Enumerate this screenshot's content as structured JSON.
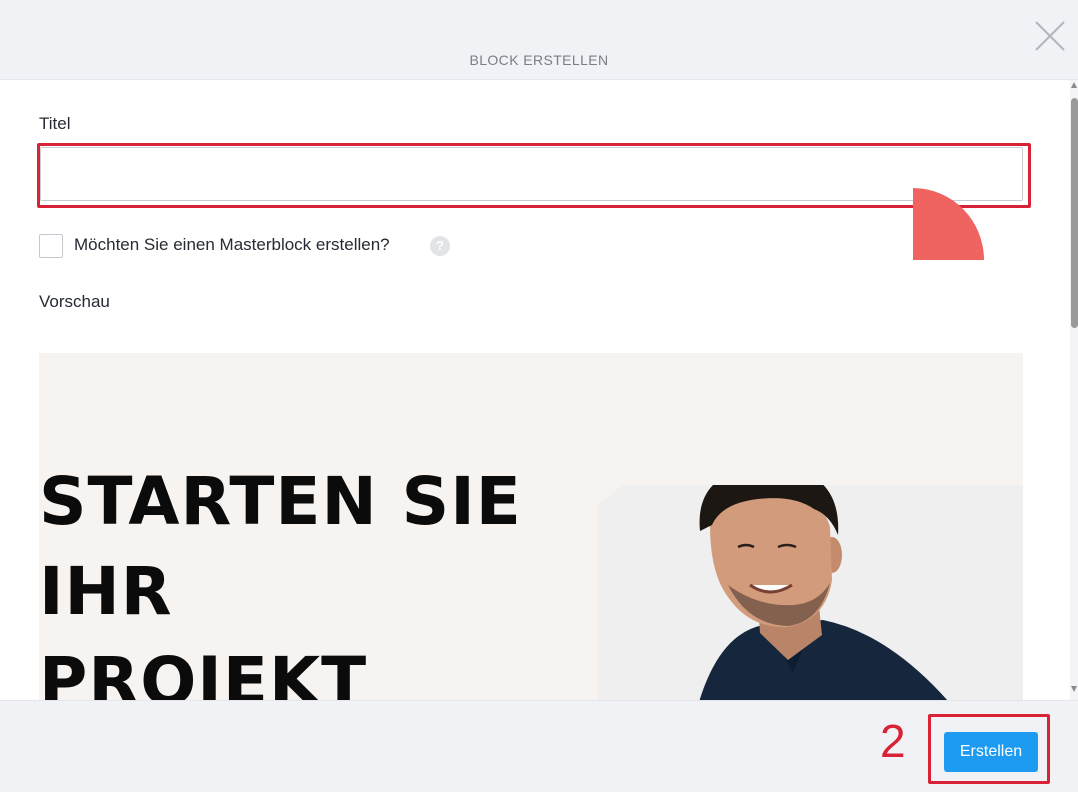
{
  "dialog": {
    "title": "BLOCK ERSTELLEN",
    "close_icon": "close-icon"
  },
  "form": {
    "title_label": "Titel",
    "title_value": "",
    "title_placeholder": "",
    "master_block_label": "Möchten Sie einen Masterblock erstellen?",
    "master_block_checked": false,
    "help_icon": "question-mark-icon",
    "help_symbol": "?",
    "preview_label": "Vorschau"
  },
  "preview": {
    "hero_line1": "STARTEN SIE",
    "hero_line2": "IHR",
    "hero_line3": "PROJEKT",
    "accent_color": "#ef6461",
    "background_color": "#f7f3f0"
  },
  "annotations": {
    "step_number": "2",
    "highlight_color": "#d92236"
  },
  "footer": {
    "submit_label": "Erstellen",
    "submit_color": "#1d9bf0"
  }
}
